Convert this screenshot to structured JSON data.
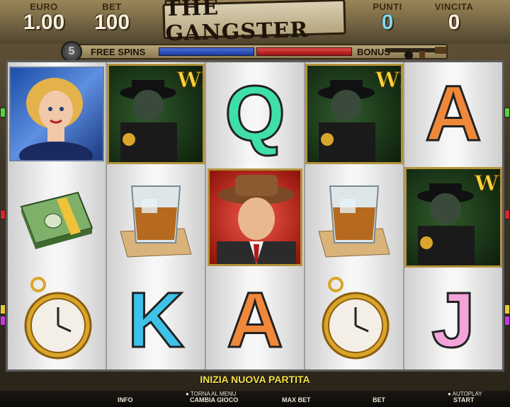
{
  "header": {
    "euro": {
      "label": "EURO",
      "value": "1.00"
    },
    "bet": {
      "label": "BET",
      "value": "100"
    },
    "punti": {
      "label": "PUNTI",
      "value": "0"
    },
    "vincita": {
      "label": "VINCITA",
      "value": "0"
    },
    "logo_text": "THE GANGSTER"
  },
  "meter": {
    "freespins_label": "FREE SPINS",
    "bonus_label": "BONUS",
    "badge": "5"
  },
  "reels": [
    [
      "lady",
      "money",
      "pocket-watch"
    ],
    [
      "wild",
      "whiskey",
      "K"
    ],
    [
      "Q",
      "gangster",
      "A"
    ],
    [
      "wild",
      "whiskey",
      "pocket-watch"
    ],
    [
      "A",
      "wild",
      "J"
    ]
  ],
  "symbols": {
    "wild_text": "WILD",
    "K": "K",
    "Q": "Q",
    "A": "A",
    "J": "J"
  },
  "message": "INIZIA NUOVA PARTITA",
  "controls": {
    "info": "INFO",
    "torna_menu": "TORNA AL MENU",
    "cambia_gioco": "CAMBIA GIOCO",
    "max_bet": "MAX BET",
    "bet": "BET",
    "autoplay": "AUTOPLAY",
    "start": "START"
  },
  "colors": {
    "Q": "#3fe0a8",
    "K": "#3ec2e8",
    "A": "#f0883a",
    "J": "#f3a3d8",
    "wild": "#f6d33a"
  }
}
